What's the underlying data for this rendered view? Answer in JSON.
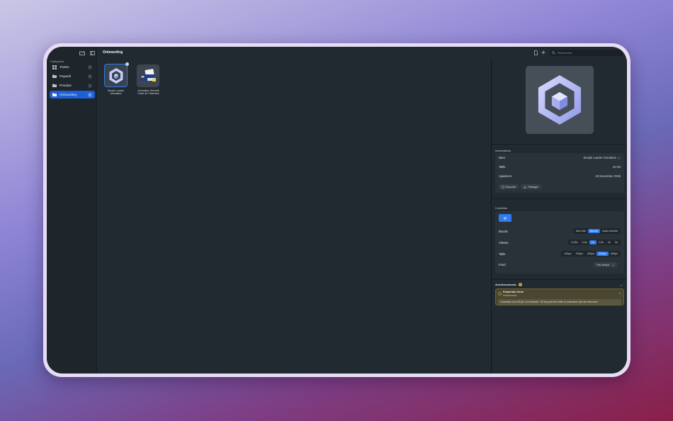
{
  "window": {
    "title": "Onboarding"
  },
  "toolbar": {
    "search_placeholder": "Rechercher",
    "icons": [
      "folder-add-icon",
      "sidebar-toggle-icon",
      "document-icon",
      "plus-icon",
      "search-icon"
    ]
  },
  "sidebar": {
    "section_title": "Catégories",
    "items": [
      {
        "label": "Toutes",
        "count": "3",
        "icon": "grid-icon",
        "selected": false
      },
      {
        "label": "Paywall",
        "count": "0",
        "icon": "folder-icon",
        "selected": false
      },
      {
        "label": "Produits",
        "count": "1",
        "icon": "folder-icon",
        "selected": false
      },
      {
        "label": "Onboarding",
        "count": "2",
        "icon": "folder-icon",
        "selected": true
      }
    ]
  },
  "grid": {
    "items": [
      {
        "line1": "Simple Loader",
        "line2": "Animation",
        "selected": true,
        "badge": "lock-icon"
      },
      {
        "line1": "Animation Sécurité",
        "line2": "Carte de Paiement",
        "selected": false
      }
    ]
  },
  "inspector": {
    "info": {
      "title": "Informations",
      "name_label": "Nom",
      "name_value": "Simple Loader Animation",
      "size_label": "Taille",
      "size_value": "16 KB",
      "added_label": "Ajoutée le",
      "added_value": "30 November 2025",
      "export_label": "Exporter",
      "share_label": "Partager"
    },
    "controls": {
      "title": "Contrôles",
      "loop_label": "Boucle",
      "loop_options": [
        "Une fois",
        "Boucle",
        "Auto-reverse"
      ],
      "loop_selected": 1,
      "speed_label": "Vitesse",
      "speed_options": [
        "0,25x",
        "0,5x",
        "1x",
        "1,5x",
        "2x",
        "3x"
      ],
      "speed_selected": 2,
      "size_label": "Taille",
      "size_options": [
        "100px",
        "150px",
        "200px",
        "300px",
        "400px"
      ],
      "size_selected": 3,
      "bg_label": "Fond",
      "bg_value": "Par défaut"
    },
    "warnings": {
      "title": "Avertissements",
      "count": "1",
      "item_title": "Framerate élevé",
      "item_subtitle": "Performance",
      "item_message": "L'animation est à 60 fps. Un framerate > 60 fps peut être inutile et consommer plus de ressources."
    }
  },
  "colors": {
    "accent": "#2f7bef",
    "warning": "#e0a53a",
    "sidebar_selected": "#1d5fd6"
  }
}
